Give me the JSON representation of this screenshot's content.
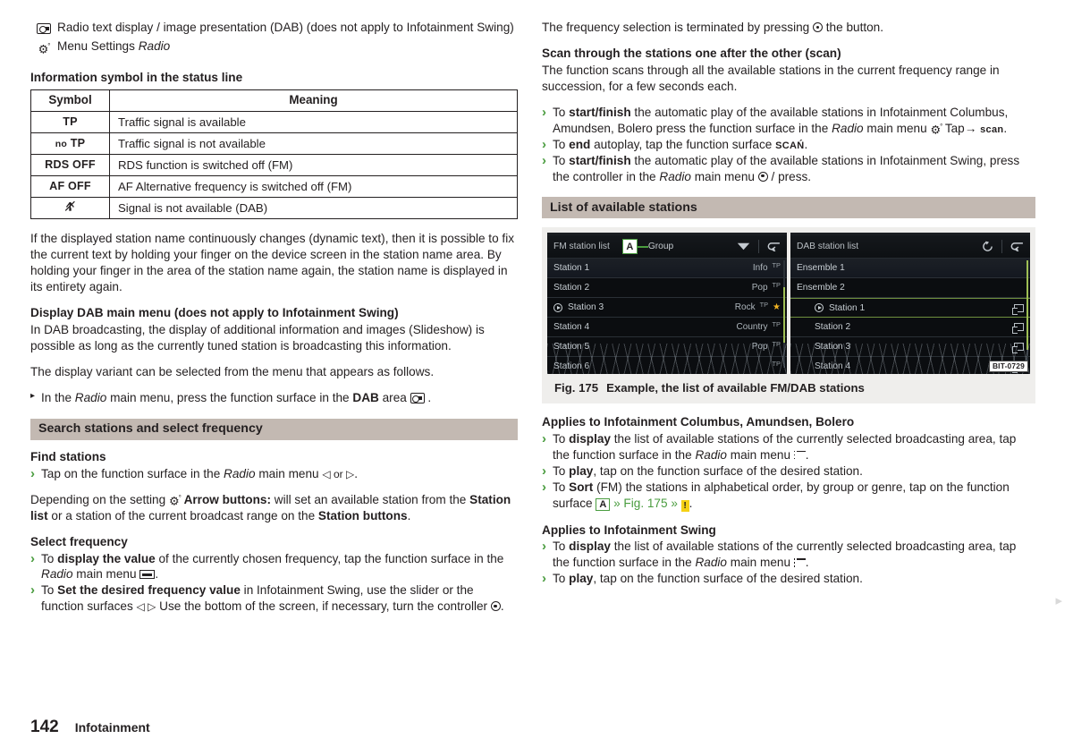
{
  "page": {
    "number": "142",
    "section": "Infotainment"
  },
  "left": {
    "legend": [
      {
        "icon": "radio-slideshow-icon",
        "text": "Radio text display / image presentation (DAB) (does not apply to Infotainment Swing)"
      },
      {
        "icon": "gear-icon",
        "text_pre": "Menu Settings ",
        "text_ital": "Radio"
      }
    ],
    "symbol_table": {
      "heading": "Information symbol in the status line",
      "columns": [
        "Symbol",
        "Meaning"
      ],
      "rows": [
        {
          "symbol": "TP",
          "meaning": "Traffic signal is available"
        },
        {
          "symbol": "no TP",
          "meaning": "Traffic signal is not available"
        },
        {
          "symbol": "RDS OFF",
          "meaning": "RDS function is switched off (FM)"
        },
        {
          "symbol": "AF OFF",
          "meaning": "AF Alternative frequency is switched off (FM)"
        },
        {
          "symbol": "signal-crossed-icon",
          "meaning": "Signal is not available (DAB)"
        }
      ]
    },
    "para_dynamic_text": "If the displayed station name continuously changes (dynamic text), then it is possible to fix the current text by holding your finger on the device screen in the station name area. By holding your finger in the area of the station name again, the station name is displayed in its entirety again.",
    "dab_menu": {
      "heading": "Display DAB main menu (does not apply to Infotainment Swing)",
      "body": "In DAB broadcasting, the display of additional information and images (Slideshow) is possible as long as the currently tuned station is broadcasting this information."
    },
    "para_variant": "The display variant can be selected from the menu that appears as follows.",
    "bullet_dab_area": {
      "pre": "In the ",
      "ital": "Radio",
      "mid": " main menu, press the function surface in the ",
      "bold": "DAB",
      "post": " area "
    },
    "band_search": "Search stations and select frequency",
    "find_stations": {
      "heading": "Find stations",
      "bullet": {
        "pre": "Tap on the function surface in the ",
        "ital": "Radio",
        "post": " main menu ",
        "icons": "◁ or ▷",
        "end": "."
      }
    },
    "para_setting": {
      "pre": "Depending on the setting ",
      "gear_label": "Arrow buttons:",
      "mid": " will set an available station from the ",
      "b1": "Station list",
      "mid2": " or a station of the current broadcast range on the ",
      "b2": "Station buttons",
      "end": "."
    },
    "select_frequency": {
      "heading": "Select frequency",
      "bullets": [
        {
          "pre": "To ",
          "bold": "display the value",
          "mid": " of the currently chosen frequency, tap the function surface in the ",
          "ital": "Radio",
          "post": " main menu ",
          "end": "."
        },
        {
          "pre": "To ",
          "bold": "Set the desired frequency value",
          "mid": " in Infotainment Swing, use the slider or the function surfaces ",
          "icons": "◁ ▷",
          "post": " Use the bottom of the screen, if necessary, turn the controller ",
          "end": "."
        }
      ]
    }
  },
  "right": {
    "para_terminate": {
      "pre": "The frequency selection is terminated by pressing ",
      "post": " the button."
    },
    "scan": {
      "heading": "Scan through the stations one after the other (scan)",
      "body": "The function scans through all the available stations in the current frequency range in succession, for a few seconds each.",
      "bullets": [
        {
          "pre": "To ",
          "bold": "start/finish",
          "mid": " the automatic play of the available stations in Infotainment Columbus, Amundsen, Bolero press the function surface in the ",
          "ital": "Radio",
          "post": " main menu ",
          "tap": "Tap→",
          "scan": "scan",
          "end": "."
        },
        {
          "pre": "To ",
          "bold": "end",
          "mid": " autoplay, tap the function surface ",
          "scan": "SCAŃ",
          "end": "."
        },
        {
          "pre": "To ",
          "bold": "start/finish",
          "mid": " the automatic play of the available stations in Infotainment Swing, press the controller in the ",
          "ital": "Radio",
          "post": " main menu ",
          "end": " / press."
        }
      ]
    },
    "band_list": "List of available stations",
    "figure": {
      "bit_code": "BIT-0729",
      "caption_num": "Fig. 175",
      "caption_text": "Example, the list of available FM/DAB stations",
      "fm_screen": {
        "title": "FM station list",
        "callout": "A",
        "group_label": "Group",
        "sort_icon": "chevron-down-icon",
        "back_icon": "back-arrow-icon",
        "rows": [
          {
            "name": "Station 1",
            "genre": "Info",
            "tp": "TP",
            "playing": false,
            "star": false
          },
          {
            "name": "Station 2",
            "genre": "Pop",
            "tp": "TP",
            "playing": false,
            "star": false
          },
          {
            "name": "Station 3",
            "genre": "Rock",
            "tp": "TP",
            "playing": true,
            "star": true
          },
          {
            "name": "Station 4",
            "genre": "Country",
            "tp": "TP",
            "playing": false,
            "star": false
          },
          {
            "name": "Station 5",
            "genre": "Pop",
            "tp": "TP",
            "playing": false,
            "star": false
          },
          {
            "name": "Station 6",
            "genre": "",
            "tp": "TP",
            "playing": false,
            "star": false
          }
        ]
      },
      "dab_screen": {
        "title": "DAB station list",
        "refresh_icon": "refresh-icon",
        "back_icon": "back-arrow-icon",
        "rows": [
          {
            "name": "Ensemble 1",
            "kind": "ensemble",
            "playing": false
          },
          {
            "name": "Ensemble 2",
            "kind": "ensemble",
            "playing": false
          },
          {
            "name": "Station 1",
            "kind": "station",
            "playing": true
          },
          {
            "name": "Station 2",
            "kind": "station",
            "playing": false
          },
          {
            "name": "Station 3",
            "kind": "station",
            "playing": false
          },
          {
            "name": "Station 4",
            "kind": "station",
            "playing": false
          }
        ]
      }
    },
    "applies_columbus": {
      "heading": "Applies to Infotainment Columbus, Amundsen, Bolero",
      "bullets": [
        {
          "pre": "To ",
          "bold": "display",
          "mid": " the list of available stations of the currently selected broadcasting area, tap the function surface in the ",
          "ital": "Radio",
          "post": " main menu ",
          "end": "."
        },
        {
          "pre": "To ",
          "bold": "play",
          "mid": ", tap on the function surface of the desired station.",
          "end": ""
        },
        {
          "pre": "To ",
          "bold": "Sort",
          "mid": " (FM) the stations in alphabetical order, by group or genre, tap on the function surface ",
          "xref_a": "A",
          "xref": "» Fig. 175 »",
          "end": "."
        }
      ]
    },
    "applies_swing": {
      "heading": "Applies to Infotainment Swing",
      "bullets": [
        {
          "pre": "To ",
          "bold": "display",
          "mid": " the list of available stations of the currently selected broadcasting area, tap the function surface in the ",
          "ital": "Radio",
          "post": " main menu ",
          "end": "."
        },
        {
          "pre": "To ",
          "bold": "play",
          "mid": ", tap on the function surface of the desired station.",
          "end": ""
        }
      ]
    }
  },
  "colors": {
    "band": "#c3b9b2",
    "accent_green": "#4a9c3f",
    "figure_bg": "#efeeec",
    "star": "#f0b323",
    "warn": "#f5d115"
  }
}
